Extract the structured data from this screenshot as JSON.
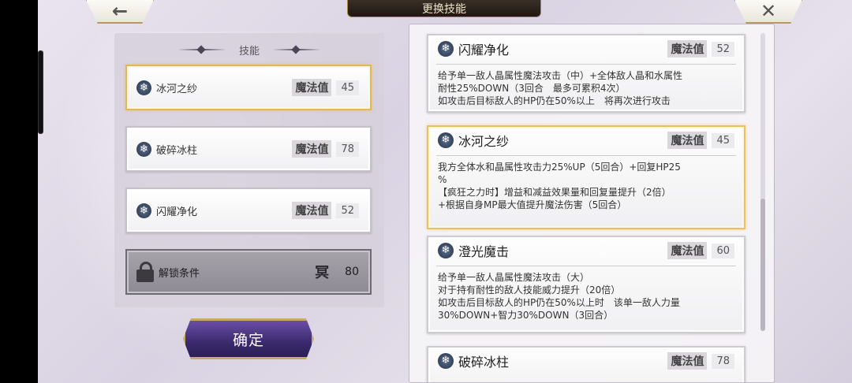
{
  "header": {
    "title": "更换技能",
    "back_icon": "←",
    "close_icon": "✕"
  },
  "left_panel": {
    "title": "技能",
    "skills": [
      {
        "name": "冰河之纱",
        "mp_label": "魔法值",
        "mp": "45",
        "selected": true
      },
      {
        "name": "破碎冰柱",
        "mp_label": "魔法值",
        "mp": "78",
        "selected": false
      },
      {
        "name": "闪耀净化",
        "mp_label": "魔法值",
        "mp": "52",
        "selected": false
      }
    ],
    "locked_slot": {
      "label": "解锁条件",
      "icon_glyph": "冥",
      "value": "80"
    }
  },
  "confirm_label": "确定",
  "skill_icon": "❄",
  "cards": [
    {
      "name": "闪耀净化",
      "mp_label": "魔法值",
      "mp": "52",
      "desc": "给予单一敌人晶属性魔法攻击（中）+全体敌人晶和水属性\n耐性25%DOWN（3回合　最多可累积4次）\n如攻击后目标敌人的HP仍在50%以上　将再次进行攻击"
    },
    {
      "name": "冰河之纱",
      "mp_label": "魔法值",
      "mp": "45",
      "desc": "我方全体水和晶属性攻击力25%UP（5回合）+回复HP25\n%\n【疯狂之力时】增益和减益效果量和回复量提升（2倍）\n+根据自身MP最大值提升魔法伤害（5回合）"
    },
    {
      "name": "澄光魔击",
      "mp_label": "魔法值",
      "mp": "60",
      "desc": "给予单一敌人晶属性魔法攻击（大）\n对于持有耐性的敌人技能威力提升（20倍）\n如攻击后目标敌人的HP仍在50%以上时　该单一敌人力量\n30%DOWN+智力30%DOWN（3回合）"
    },
    {
      "name": "破碎冰柱",
      "mp_label": "魔法值",
      "mp": "78",
      "desc": ""
    }
  ],
  "colors": {
    "selected_border": "#e2b75a",
    "confirm_bg": "#3b2a6e"
  }
}
